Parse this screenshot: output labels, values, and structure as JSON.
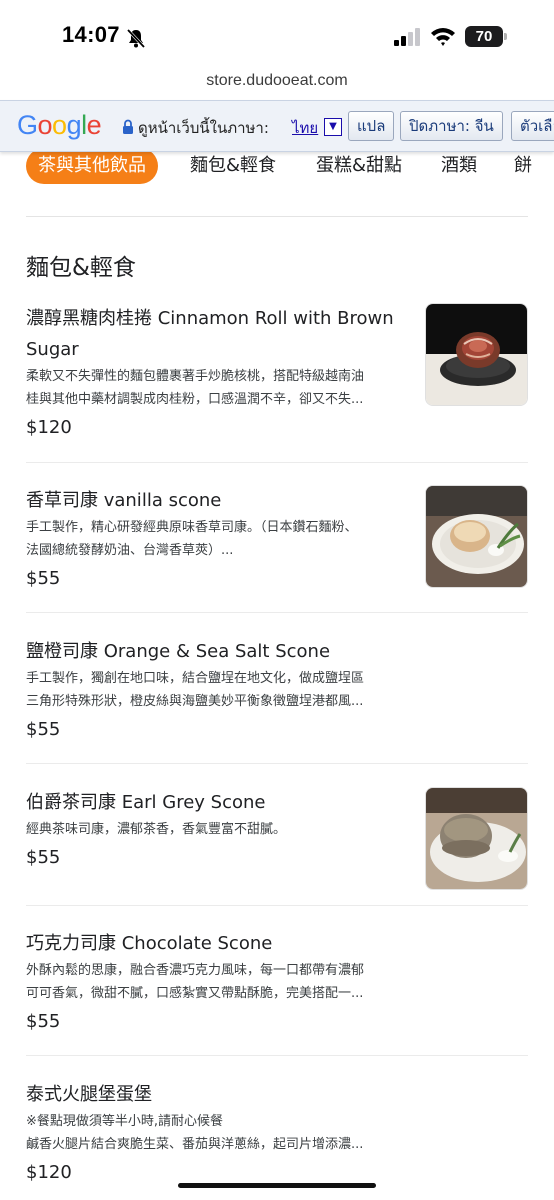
{
  "status": {
    "time": "14:07",
    "battery": "70"
  },
  "browser": {
    "url": "store.dudooeat.com"
  },
  "translate_bar": {
    "logo": "Google",
    "prompt": "ดูหน้าเว็บนี้ในภาษา:",
    "language": "ไทย",
    "translate_button": "แปล",
    "turn_off_button": "ปิดภาษา: จีน",
    "options_button": "ตัวเลือก"
  },
  "categories": [
    {
      "label": "茶與其他飲品",
      "active": true
    },
    {
      "label": "麵包&輕食",
      "active": false
    },
    {
      "label": "蛋糕&甜點",
      "active": false
    },
    {
      "label": "酒類",
      "active": false
    },
    {
      "label": "餅",
      "active": false
    }
  ],
  "section": {
    "title": "麵包&輕食"
  },
  "items": [
    {
      "name_line1": "濃醇黑糖肉桂捲 Cinnamon Roll with Brown",
      "name_line2": "Sugar",
      "desc_line1": "柔軟又不失彈性的麵包體裹著手炒脆核桃，搭配特級越南油",
      "desc_line2": "桂與其他中藥材調製成肉桂粉，口感溫潤不辛，卻又不失...",
      "price": "$120",
      "photo": "cinnamon-roll"
    },
    {
      "name_line1": "香草司康 vanilla scone",
      "desc_line1": "手工製作，精心研發經典原味香草司康。（日本鑽石麵粉、",
      "desc_line2": "法國總統發酵奶油、台灣香草莢）...",
      "price": "$55",
      "photo": "vanilla-scone"
    },
    {
      "name_line1": "鹽橙司康 Orange & Sea Salt Scone",
      "desc_line1": "手工製作，獨創在地口味，結合鹽埕在地文化，做成鹽埕區",
      "desc_line2": "三角形特殊形狀，橙皮絲與海鹽美妙平衡象徵鹽埕港都風...",
      "price": "$55"
    },
    {
      "name_line1": "伯爵茶司康 Earl Grey Scone",
      "desc_line1": "經典茶味司康，濃郁茶香，香氣豐富不甜膩。",
      "price": "$55",
      "photo": "earl-grey-scone"
    },
    {
      "name_line1": "巧克力司康 Chocolate Scone",
      "desc_line1": "外酥內鬆的思康，融合香濃巧克力風味，每一口都帶有濃郁",
      "desc_line2": "可可香氣，微甜不膩，口感紮實又帶點酥脆，完美搭配一...",
      "price": "$55"
    },
    {
      "name_line1": "泰式火腿堡蛋堡",
      "desc_line1": "※餐點現做須等半小時,請耐心候餐",
      "desc_line2": "鹹香火腿片結合爽脆生菜、番茄與洋蔥絲，起司片增添濃...",
      "price": "$120"
    }
  ],
  "colors": {
    "accent": "#f57f17",
    "text": "#202124",
    "translate_bg": "#eef2f8"
  }
}
